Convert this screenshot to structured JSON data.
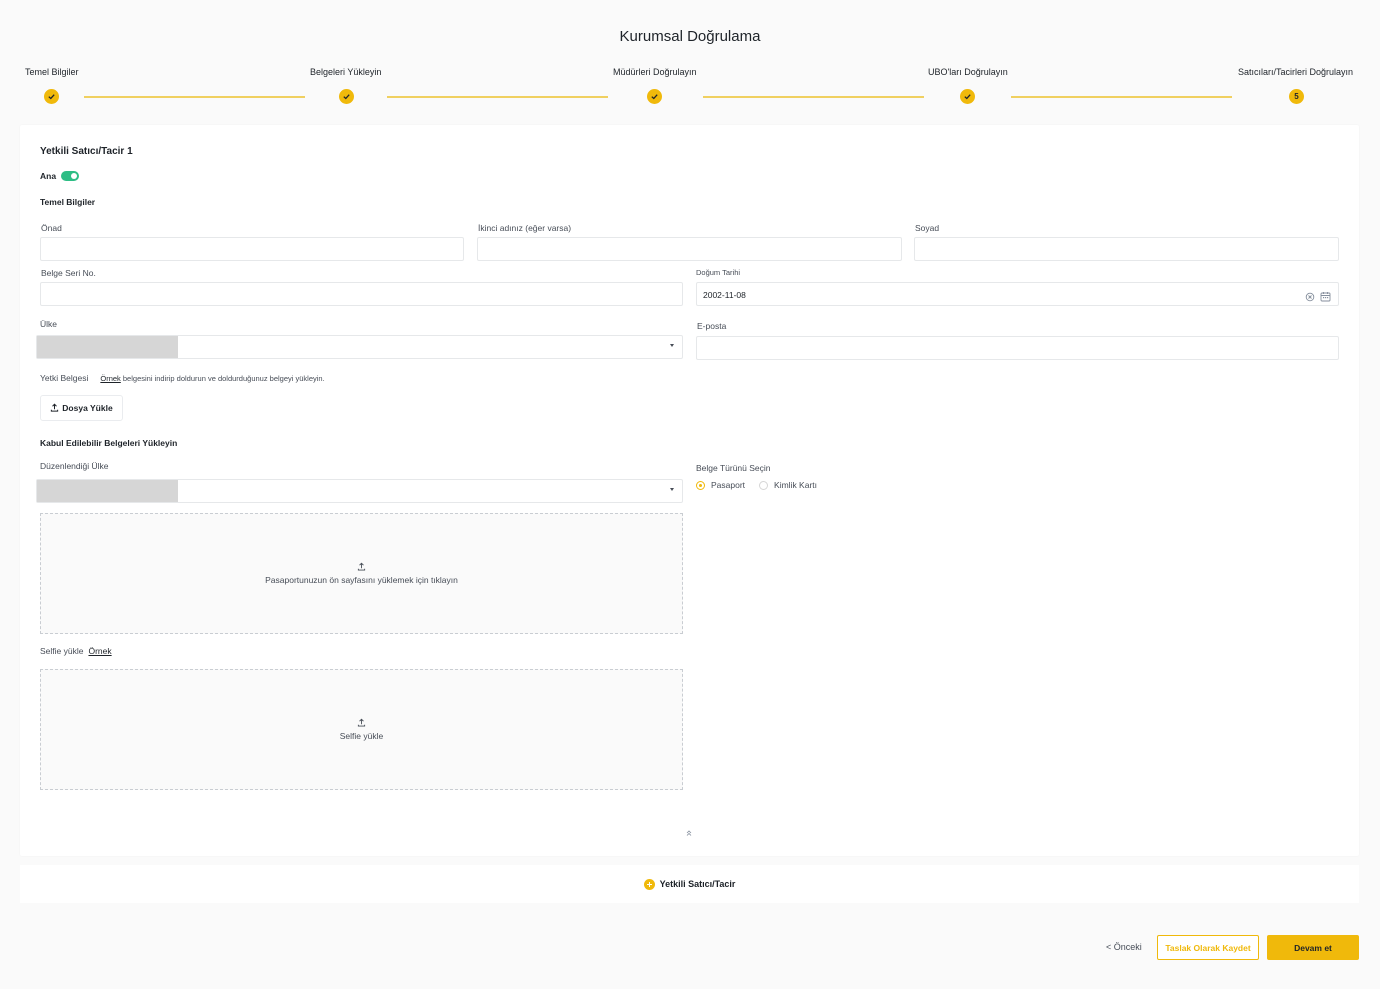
{
  "header": {
    "title": "Kurumsal Doğrulama"
  },
  "stepper": {
    "steps": [
      {
        "label": "Temel Bilgiler",
        "status": "done"
      },
      {
        "label": "Belgeleri Yükleyin",
        "status": "done"
      },
      {
        "label": "Müdürleri Doğrulayın",
        "status": "done"
      },
      {
        "label": "UBO'ları Doğrulayın",
        "status": "done"
      },
      {
        "label": "Satıcıları/Tacirleri Doğrulayın",
        "status": "current",
        "number": "5"
      }
    ],
    "accent_color": "#f0b90b"
  },
  "form": {
    "title": "Yetkili Satıcı/Tacir 1",
    "main_toggle": {
      "label": "Ana",
      "on": true
    },
    "basic_info_title": "Temel Bilgiler",
    "first_name": {
      "label": "Önad",
      "value": ""
    },
    "middle_name": {
      "label": "İkinci adınız (eğer varsa)",
      "value": ""
    },
    "last_name": {
      "label": "Soyad",
      "value": ""
    },
    "doc_serial": {
      "label": "Belge Seri No.",
      "value": ""
    },
    "birth_date": {
      "label": "Doğum Tarihi",
      "value": "2002-11-08"
    },
    "country": {
      "label": "Ülke",
      "value": ""
    },
    "email": {
      "label": "E-posta",
      "value": ""
    },
    "authority_doc": {
      "label": "Yetki Belgesi",
      "example_link": "Örnek",
      "hint": "belgesini indirip doldurun ve doldurduğunuz belgeyi yükleyin.",
      "upload_button": "Dosya Yükle"
    },
    "accepted_docs_title": "Kabul Edilebilir Belgeleri Yükleyin",
    "issuing_country": {
      "label": "Düzenlendiği Ülke",
      "value": ""
    },
    "doc_type": {
      "label": "Belge Türünü Seçin",
      "options": [
        "Pasaport",
        "Kimlik Kartı"
      ],
      "selected": "Pasaport"
    },
    "passport_upload": {
      "text": "Pasaportunuzun ön sayfasını yüklemek için tıklayın"
    },
    "selfie": {
      "label": "Selfie yükle",
      "example_link": "Örnek",
      "upload_text": "Selfie yükle"
    }
  },
  "add_merchant": {
    "label": "Yetkili Satıcı/Tacir"
  },
  "footer": {
    "prev": "< Önceki",
    "save_draft": "Taslak Olarak Kaydet",
    "continue": "Devam et"
  }
}
